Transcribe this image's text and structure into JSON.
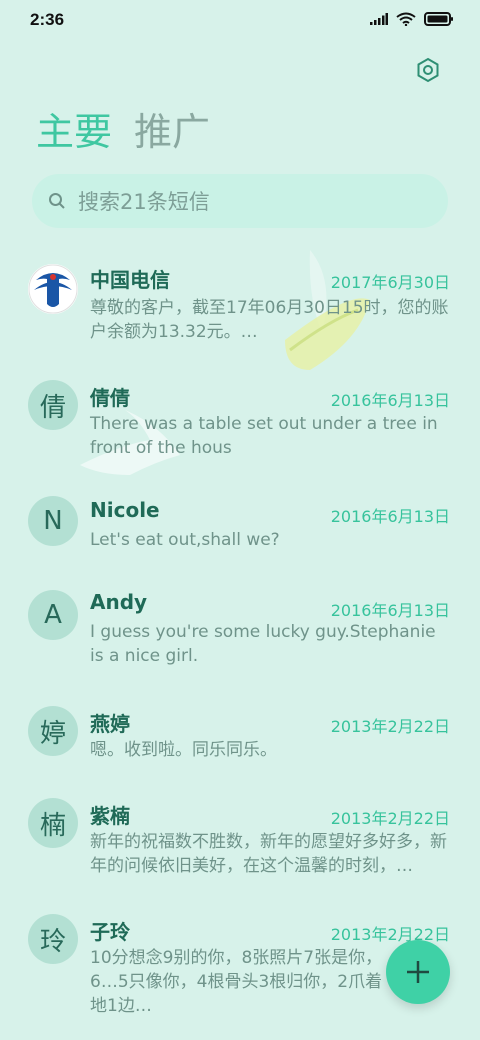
{
  "status": {
    "time": "2:36"
  },
  "tabs": [
    {
      "label": "主要"
    },
    {
      "label": "推广"
    }
  ],
  "search": {
    "placeholder": "搜索21条短信"
  },
  "messages": [
    {
      "avatar": "",
      "name": "中国电信",
      "date": "2017年6月30日",
      "preview": "尊敬的客户，截至17年06月30日15时，您的账户余额为13.32元。…"
    },
    {
      "avatar": "倩",
      "name": "倩倩",
      "date": "2016年6月13日",
      "preview": "There was a table set out under a tree in front of the hous"
    },
    {
      "avatar": "N",
      "name": "Nicole",
      "date": "2016年6月13日",
      "preview": "Let's eat out,shall we?"
    },
    {
      "avatar": "A",
      "name": "Andy",
      "date": "2016年6月13日",
      "preview": "I guess you're some lucky guy.Stephanie is a nice girl."
    },
    {
      "avatar": "婷",
      "name": "燕婷",
      "date": "2013年2月22日",
      "preview": "嗯。收到啦。同乐同乐。"
    },
    {
      "avatar": "楠",
      "name": "紫楠",
      "date": "2013年2月22日",
      "preview": "新年的祝福数不胜数，新年的愿望好多好多，新年的问候依旧美好，在这个温馨的时刻，…"
    },
    {
      "avatar": "玲",
      "name": "子玲",
      "date": "2013年2月22日",
      "preview": "10分想念9别的你，8张照片7张是你，6…5只像你，4根骨头3根归你，2爪着地1边…"
    }
  ],
  "icons": {
    "signal": "signal-icon",
    "wifi": "wifi-icon",
    "battery": "battery-icon",
    "settings": "settings-icon",
    "search": "search-icon",
    "compose": "plus-icon"
  },
  "colors": {
    "accent": "#3fc7a1",
    "background": "#d7f2ea",
    "fab": "#3fd1a6"
  }
}
